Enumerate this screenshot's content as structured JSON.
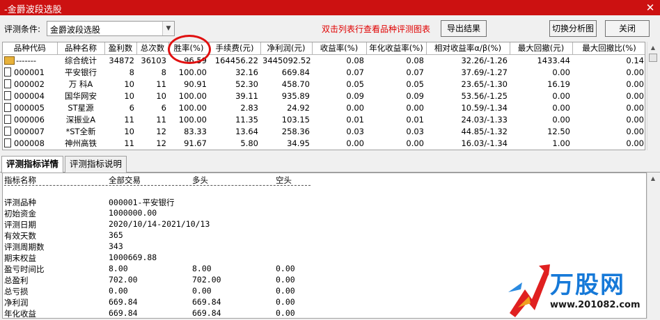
{
  "window": {
    "title": "-金爵波段选股",
    "close_glyph": "✕"
  },
  "toolbar": {
    "condition_label": "评测条件:",
    "condition_value": "金爵波段选股",
    "hint": "双击列表行查看品种评测图表",
    "export_label": "导出结果",
    "switch_label": "切换分析图",
    "close_label": "关闭"
  },
  "grid": {
    "headers": [
      "品种代码",
      "品种名称",
      "盈利数",
      "总次数",
      "胜率(%)",
      "手续费(元)",
      "净利润(元)",
      "收益率(%)",
      "年化收益率(%)",
      "相对收益率α/β(%)",
      "最大回撤(元)",
      "最大回撤比(%)"
    ],
    "rows": [
      [
        "-------",
        "综合统计",
        "34872",
        "36103",
        "96.59",
        "164456.22",
        "3445092.52",
        "0.08",
        "0.08",
        "32.26/-1.26",
        "1433.44",
        "0.14"
      ],
      [
        "000001",
        "平安银行",
        "8",
        "8",
        "100.00",
        "32.16",
        "669.84",
        "0.07",
        "0.07",
        "37.69/-1.27",
        "0.00",
        "0.00"
      ],
      [
        "000002",
        "万 科A",
        "10",
        "11",
        "90.91",
        "52.30",
        "458.70",
        "0.05",
        "0.05",
        "23.65/-1.30",
        "16.19",
        "0.00"
      ],
      [
        "000004",
        "国华网安",
        "10",
        "10",
        "100.00",
        "39.11",
        "935.89",
        "0.09",
        "0.09",
        "53.56/-1.25",
        "0.00",
        "0.00"
      ],
      [
        "000005",
        "ST星源",
        "6",
        "6",
        "100.00",
        "2.83",
        "24.92",
        "0.00",
        "0.00",
        "10.59/-1.34",
        "0.00",
        "0.00"
      ],
      [
        "000006",
        "深振业A",
        "11",
        "11",
        "100.00",
        "11.35",
        "103.15",
        "0.01",
        "0.01",
        "24.03/-1.33",
        "0.00",
        "0.00"
      ],
      [
        "000007",
        "*ST全新",
        "10",
        "12",
        "83.33",
        "13.64",
        "258.36",
        "0.03",
        "0.03",
        "44.85/-1.32",
        "12.50",
        "0.00"
      ],
      [
        "000008",
        "神州高铁",
        "11",
        "12",
        "91.67",
        "5.80",
        "34.95",
        "0.00",
        "0.00",
        "16.03/-1.34",
        "1.00",
        "0.00"
      ]
    ]
  },
  "tabs": [
    "评测指标详情",
    "评测指标说明"
  ],
  "detail": {
    "header": [
      "指标名称",
      "全部交易",
      "多头",
      "空头"
    ],
    "rows": [
      [
        "评测品种",
        "000001-平安银行",
        "",
        ""
      ],
      [
        "初始资金",
        "1000000.00",
        "",
        ""
      ],
      [
        "评测日期",
        "2020/10/14-2021/10/13",
        "",
        ""
      ],
      [
        "有效天数",
        "365",
        "",
        ""
      ],
      [
        "评测周期数",
        "343",
        "",
        ""
      ],
      [
        "期末权益",
        "1000669.88",
        "",
        ""
      ],
      [
        "盈亏时间比",
        "8.00",
        "8.00",
        "0.00"
      ],
      [
        "总盈利",
        "702.00",
        "702.00",
        "0.00"
      ],
      [
        "总亏损",
        "0.00",
        "0.00",
        "0.00"
      ],
      [
        "净利润",
        "669.84",
        "669.84",
        "0.00"
      ],
      [
        "年化收益",
        "669.84",
        "669.84",
        "0.00"
      ]
    ]
  },
  "watermark": {
    "brand": "万股网",
    "url": "www.201082.com"
  },
  "colors": {
    "titlebar": "#cc1111",
    "hint": "#e00000",
    "circle": "#e01010",
    "watermark": "#1679d8"
  }
}
